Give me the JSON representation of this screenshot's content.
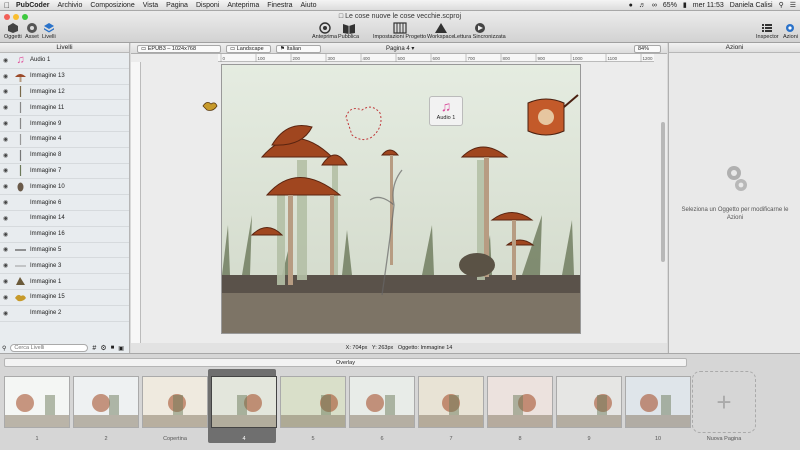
{
  "menubar": {
    "app": "PubCoder",
    "menus": [
      "Archivio",
      "Composizione",
      "Vista",
      "Pagina",
      "Disponi",
      "Anteprima",
      "Finestra",
      "Aiuto"
    ],
    "battery": "65%",
    "clock": "mer 11:53",
    "user": "Daniela Calisi"
  },
  "window": {
    "title": "Le cose nuove le cose vecchie.scproj"
  },
  "toolbar": {
    "left": [
      {
        "label": "Oggetti",
        "icon": "objects-icon"
      },
      {
        "label": "Asset",
        "icon": "asset-icon"
      },
      {
        "label": "Livelli",
        "icon": "layers-icon"
      }
    ],
    "center": [
      {
        "label": "Anteprima",
        "icon": "eye-icon"
      },
      {
        "label": "Pubblica",
        "icon": "book-icon"
      },
      {
        "label": "Impostazioni Progetto",
        "icon": "settings-icon"
      },
      {
        "label": "Workspace",
        "icon": "workspace-icon"
      },
      {
        "label": "Lettura Sincronizzata",
        "icon": "sync-read-icon"
      }
    ],
    "right": [
      {
        "label": "Inspector",
        "icon": "inspector-icon"
      },
      {
        "label": "Azioni",
        "icon": "actions-icon"
      }
    ]
  },
  "left_panel": {
    "title": "Livelli",
    "layers": [
      {
        "name": "Audio 1",
        "thumb": "music-note-icon",
        "color": "#e0529c"
      },
      {
        "name": "Immagine 13",
        "thumb": "mushroom-icon",
        "color": "#9b4a2a"
      },
      {
        "name": "Immagine 12",
        "thumb": "leaf-icon",
        "color": "#7a6a4a"
      },
      {
        "name": "Immagine 11",
        "thumb": "stem-icon",
        "color": "#888888"
      },
      {
        "name": "Immagine 9",
        "thumb": "stem-icon",
        "color": "#888888"
      },
      {
        "name": "Immagine 4",
        "thumb": "stem-icon",
        "color": "#999999"
      },
      {
        "name": "Immagine 8",
        "thumb": "figure-icon",
        "color": "#777777"
      },
      {
        "name": "Immagine 7",
        "thumb": "stem-icon",
        "color": "#6d7a5a"
      },
      {
        "name": "Immagine 10",
        "thumb": "egg-icon",
        "color": "#6a5a4a"
      },
      {
        "name": "Immagine 6",
        "thumb": "blank-icon",
        "color": "#cccccc"
      },
      {
        "name": "Immagine 14",
        "thumb": "blank-icon",
        "color": "#cccccc"
      },
      {
        "name": "Immagine 16",
        "thumb": "blank-icon",
        "color": "#cccccc"
      },
      {
        "name": "Immagine 5",
        "thumb": "line-icon",
        "color": "#555555"
      },
      {
        "name": "Immagine 3",
        "thumb": "line-icon",
        "color": "#aaaaaa"
      },
      {
        "name": "Immagine 1",
        "thumb": "tree-icon",
        "color": "#6b5a3a"
      },
      {
        "name": "Immagine 15",
        "thumb": "bird-icon",
        "color": "#c79a2a"
      },
      {
        "name": "Immagine 2",
        "thumb": "blank-icon",
        "color": "#cccccc"
      }
    ],
    "search_placeholder": "Cerca Livelli"
  },
  "center_toolbar": {
    "device": "EPUB3 – 1024x768",
    "orientation": "Landscape",
    "language": "Italian",
    "page_label": "Pagina 4",
    "zoom": "84%"
  },
  "ruler": {
    "ticks": [
      "0",
      "100",
      "200",
      "300",
      "400",
      "500",
      "600",
      "700",
      "800",
      "900",
      "1000",
      "1100",
      "1200"
    ]
  },
  "canvas": {
    "audio_label": "Audio 1"
  },
  "status": {
    "x": "X: 704px",
    "y": "Y: 263px",
    "object": "Oggetto: Immagine 14"
  },
  "right_panel": {
    "title": "Azioni",
    "hint": "Seleziona un Oggetto per modificarne le Azioni"
  },
  "bottom": {
    "overlay_label": "Overlay",
    "pages": [
      {
        "label": "1",
        "bg": "#f4f6f4"
      },
      {
        "label": "2",
        "bg": "#eef1f2"
      },
      {
        "label": "Copertina",
        "bg": "#efeadf"
      },
      {
        "label": "4",
        "bg": "#e3e6dc",
        "selected": true
      },
      {
        "label": "5",
        "bg": "#d9dfc9"
      },
      {
        "label": "6",
        "bg": "#e8ece8"
      },
      {
        "label": "7",
        "bg": "#e8e3d5"
      },
      {
        "label": "8",
        "bg": "#ece2de"
      },
      {
        "label": "9",
        "bg": "#e6e6e4"
      },
      {
        "label": "10",
        "bg": "#dfe5ea"
      }
    ],
    "new_page_label": "Nuova Pagina"
  }
}
